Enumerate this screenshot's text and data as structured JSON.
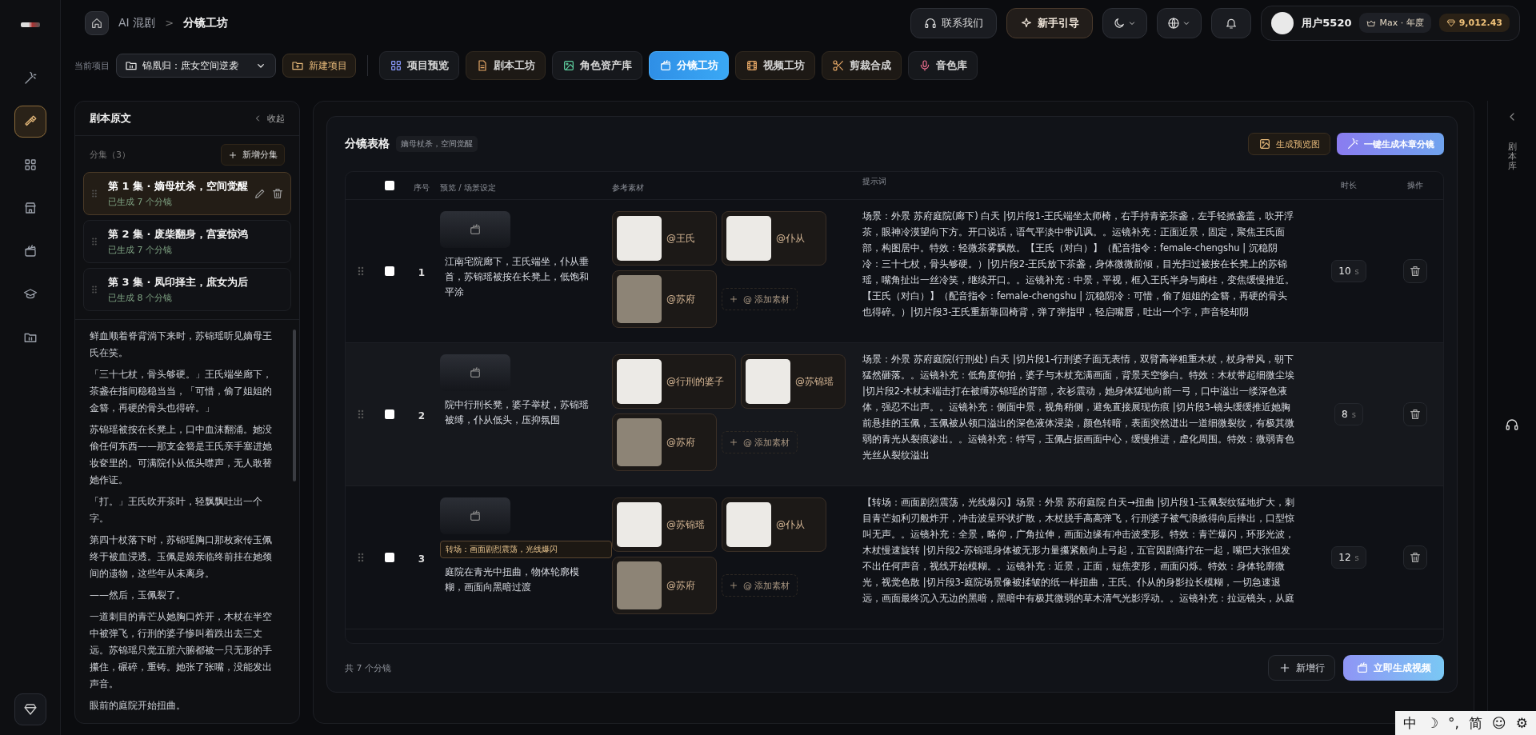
{
  "breadcrumb": {
    "root": "AI 混剧",
    "separator": ">",
    "current": "分镜工坊"
  },
  "top_actions": {
    "contact": "联系我们",
    "guide": "新手引导",
    "dark_mode": true
  },
  "user": {
    "name": "用户5520",
    "plan": "Max · 年度",
    "credits": "9,012.43"
  },
  "project_bar": {
    "label": "当前项目",
    "project": "锦凰归：庶女空间逆袭",
    "new_project": "新建项目"
  },
  "tabs": [
    {
      "label": "项目预览",
      "selected": false
    },
    {
      "label": "剧本工坊",
      "selected": false
    },
    {
      "label": "角色资产库",
      "selected": false
    },
    {
      "label": "分镜工坊",
      "selected": true
    },
    {
      "label": "视频工坊",
      "selected": false
    },
    {
      "label": "剪裁合成",
      "selected": false
    },
    {
      "label": "音色库",
      "selected": false
    }
  ],
  "sidebar": {
    "items": [
      {
        "selected": false
      },
      {
        "selected": true
      },
      {
        "selected": false
      },
      {
        "selected": false
      },
      {
        "selected": false
      },
      {
        "selected": false
      },
      {
        "selected": false
      }
    ]
  },
  "script_panel": {
    "title": "剧本原文",
    "collapse": "收起",
    "episodes_label": "分集（3）",
    "add_episode": "新增分集",
    "episodes": [
      {
        "title": "第 1 集 · 嫡母杖杀，空间觉醒",
        "status": "已生成 7 个分镜",
        "selected": true
      },
      {
        "title": "第 2 集 · 废柴翻身，宫宴惊鸿",
        "status": "已生成 7 个分镜",
        "selected": false
      },
      {
        "title": "第 3 集 · 凤印择主，庶女为后",
        "status": "已生成 8 个分镜",
        "selected": false
      }
    ],
    "paragraphs": [
      "鲜血顺着脊背淌下来时，苏锦瑶听见嫡母王氏在笑。",
      "「三十七杖，骨头够硬。」王氏端坐廊下，茶盏在指间稳稳当当，「可惜，偷了姐姐的金簪，再硬的骨头也得碎。」",
      "苏锦瑶被按在长凳上，口中血沫翻涌。她没偷任何东西——那支金簪是王氏亲手塞进她妆奁里的。可满院仆从低头噤声，无人敢替她作证。",
      "「打。」王氏吹开茶叶，轻飘飘吐出一个字。",
      "第四十杖落下时，苏锦瑶胸口那枚家传玉佩终于被血浸透。玉佩是娘亲临终前挂在她颈间的遗物，这些年从未离身。",
      "——然后，玉佩裂了。",
      "一道刺目的青芒从她胸口炸开，木杖在半空中被弹飞，行刑的婆子惨叫着跌出去三丈远。苏锦瑶只觉五脏六腑都被一只无形的手攥住，碾碎，重铸。她张了张嘴，没能发出声音。",
      "眼前的庭院开始扭曲。"
    ]
  },
  "storyboard": {
    "title": "分镜表格",
    "episode_tag": "嫡母杖杀，空间觉醒",
    "preview_button": "生成预览图",
    "generate_button": "一键生成本章分镜",
    "columns": [
      "序号",
      "预览 / 场景设定",
      "参考素材",
      "提示词",
      "时长",
      "操作"
    ],
    "select_all": {
      "checked": false
    },
    "rows": [
      {
        "number": "1",
        "checked": false,
        "transition": null,
        "scene": "江南宅院廊下，王氏端坐，仆从垂首，苏锦瑶被按在长凳上，低饱和平涂",
        "assets": [
          {
            "label": "@王氏",
            "kind": "character"
          },
          {
            "label": "@仆从",
            "kind": "character"
          },
          {
            "label": "@苏府",
            "kind": "scene"
          }
        ],
        "add_asset": "@ 添加素材",
        "prompt": "场景：外景 苏府庭院(廊下) 白天 |切片段1-王氏端坐太师椅，右手持青瓷茶盏，左手轻掀盏盖，吹开浮茶，眼神冷漠望向下方。开口说话，语气平淡中带讥讽。。运镜补充：正面近景，固定，聚焦王氏面部，构图居中。特效：轻微茶雾飘散。【王氏（对白）】（配音指令：female-chengshu | 沉稳阴冷：三十七杖，骨头够硬。）|切片段2-王氏放下茶盏，身体微微前倾，目光扫过被按在长凳上的苏锦瑶，嘴角扯出一丝冷笑，继续开口。。运镜补充：中景，平视，框入王氏半身与廊柱，变焦缓慢推近。【王氏（对白）】（配音指令：female-chengshu | 沉稳阴冷：可惜，偷了姐姐的金簪，再硬的骨头也得碎。）|切片段3-王氏重新靠回椅背，弹了弹指甲，轻启嘴唇，吐出一个字，声音轻却阴",
        "duration": "10",
        "unit": "s"
      },
      {
        "number": "2",
        "checked": false,
        "transition": null,
        "scene": "院中行刑长凳，婆子举杖，苏锦瑶被缚，仆从低头，压抑氛围",
        "assets": [
          {
            "label": "@行刑的婆子",
            "kind": "character"
          },
          {
            "label": "@苏锦瑶",
            "kind": "character"
          },
          {
            "label": "@苏府",
            "kind": "scene"
          }
        ],
        "add_asset": "@ 添加素材",
        "prompt": "场景：外景 苏府庭院(行刑处) 白天 |切片段1-行刑婆子面无表情，双臂高举粗重木杖，杖身带风，朝下猛然砸落。。运镜补充：低角度仰拍，婆子与木杖充满画面，背景天空惨白。特效：木杖带起细微尘埃 |切片段2-木杖末端击打在被缚苏锦瑶的背部，衣衫震动，她身体猛地向前一弓，口中溢出一缕深色液体，强忍不出声。。运镜补充：侧面中景，视角稍侧，避免直接展现伤痕 |切片段3-镜头缓缓推近她胸前悬挂的玉佩，玉佩被从领口溢出的深色液体浸染，颜色转暗，表面突然迸出一道细微裂纹，有极其微弱的青光从裂痕渗出。。运镜补充：特写，玉佩占据画面中心，缓慢推进，虚化周围。特效：微弱青色光丝从裂纹溢出",
        "duration": "8",
        "unit": "s"
      },
      {
        "number": "3",
        "checked": false,
        "transition": "转场：画面剧烈震荡，光线爆闪",
        "scene": "庭院在青光中扭曲，物体轮廓模糊，画面向黑暗过渡",
        "assets": [
          {
            "label": "@苏锦瑶",
            "kind": "character"
          },
          {
            "label": "@仆从",
            "kind": "character"
          },
          {
            "label": "@苏府",
            "kind": "scene"
          }
        ],
        "add_asset": "@ 添加素材",
        "prompt": "【转场：画面剧烈震荡，光线爆闪】场景：外景 苏府庭院 白天→扭曲 |切片段1-玉佩裂纹猛地扩大，刺目青芒如利刃般炸开，冲击波呈环状扩散，木杖脱手高高弹飞，行刑婆子被气浪掀得向后摔出，口型惊叫无声。。运镜补充：全景，略仰，广角拉伸，画面边缘有冲击波变形。特效：青芒爆闪，环形光波，木杖慢速旋转 |切片段2-苏锦瑶身体被无形力量攥紧般向上弓起，五官因剧痛拧在一起，嘴巴大张但发不出任何声音，视线开始模糊。。运镜补充：近景，正面，短焦变形，画面闪烁。特效：身体轮廓微光，视觉色散 |切片段3-庭院场景像被揉皱的纸一样扭曲，王氏、仆从的身影拉长模糊，一切急速退远，画面最终沉入无边的黑暗，黑暗中有极其微弱的草木清气光影浮动。。运镜补充：拉远镜头，从庭",
        "duration": "12",
        "unit": "s"
      }
    ],
    "count": "共 7 个分镜",
    "add_row": "新增行",
    "generate_video": "立即生成视频"
  },
  "right_panel": {
    "label": "剧本库"
  },
  "ime_bar": [
    "中",
    "☽",
    "°,",
    "简",
    "☺",
    "⚙"
  ]
}
